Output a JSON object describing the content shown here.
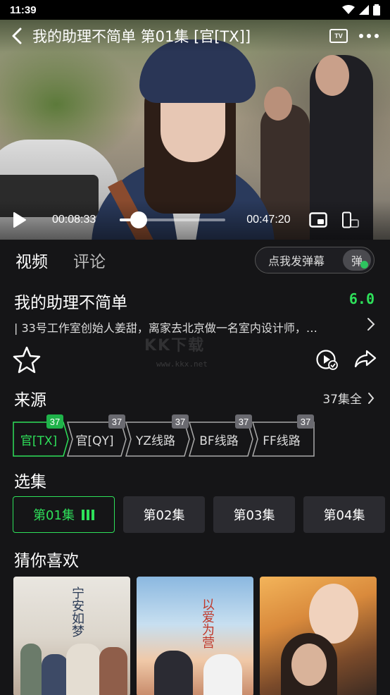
{
  "status_bar": {
    "time": "11:39"
  },
  "player": {
    "title": "我的助理不简单 第01集 [官[TX]]",
    "current_time": "00:08:33",
    "total_time": "00:47:20",
    "progress_fraction": 0.18,
    "tv_label": "TV"
  },
  "tabs": {
    "video": "视频",
    "comments": "评论"
  },
  "danmu": {
    "label": "点我发弹幕",
    "badge": "弹"
  },
  "show": {
    "title": "我的助理不简单",
    "rating": "6.0",
    "description": "| 33号工作室创始人姜甜，离家去北京做一名室内设计师，…"
  },
  "watermark": {
    "text": "KK下载",
    "url": "www.kkx.net"
  },
  "source": {
    "title": "来源",
    "count_label": "37集全",
    "items": [
      {
        "label": "官[TX]",
        "count": "37",
        "active": true
      },
      {
        "label": "官[QY]",
        "count": "37",
        "active": false
      },
      {
        "label": "YZ线路",
        "count": "37",
        "active": false
      },
      {
        "label": "BF线路",
        "count": "37",
        "active": false
      },
      {
        "label": "FF线路",
        "count": "37",
        "active": false
      }
    ]
  },
  "episodes": {
    "title": "选集",
    "items": [
      "第01集",
      "第02集",
      "第03集",
      "第04集"
    ]
  },
  "recommend": {
    "title": "猜你喜欢",
    "poster_texts": [
      "宁安如梦",
      "以爱为营"
    ]
  },
  "colors": {
    "accent": "#2ee05a",
    "background": "#151517",
    "badge_active": "#1fb34a"
  }
}
